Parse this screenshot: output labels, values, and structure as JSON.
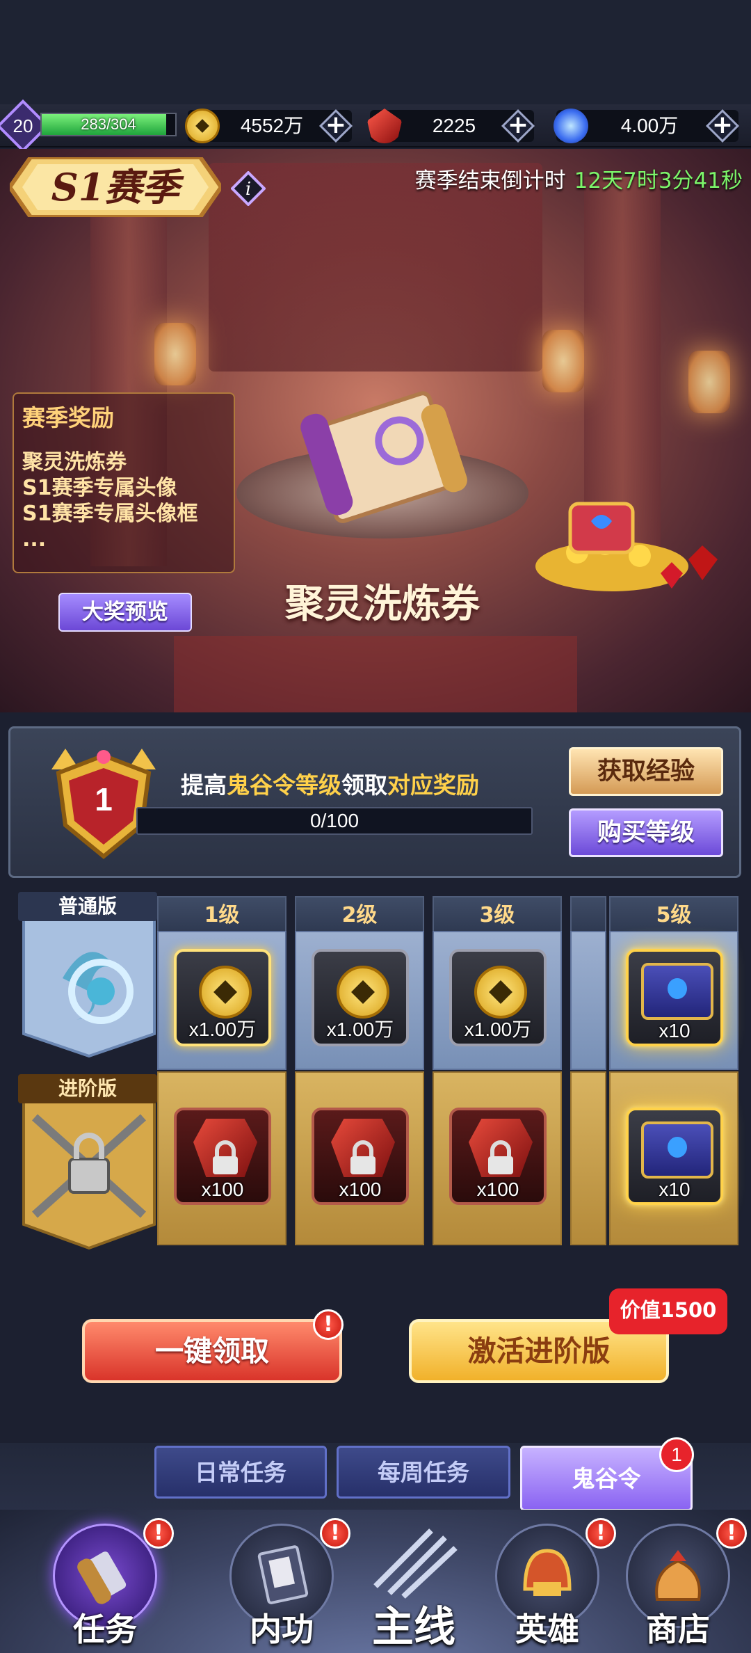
{
  "status_bar": {
    "level": "20",
    "xp": "283/304",
    "xp_fraction": 0.93,
    "gold": "4552万",
    "ruby": "2225",
    "crystal": "4.00万"
  },
  "banner": {
    "season_title": "S1赛季",
    "countdown_label": "赛季结束倒计时",
    "countdown_value": "12天7时3分41秒",
    "rewards_title": "赛季奖励",
    "rewards": [
      "聚灵洗炼券",
      "S1赛季专属头像",
      "S1赛季专属头像框",
      "..."
    ],
    "preview_button": "大奖预览",
    "featured_prize": "聚灵洗炼券"
  },
  "level_panel": {
    "current_level": "1",
    "desc_part1": "提高",
    "desc_hl1": "鬼谷令等级",
    "desc_part2": "领取",
    "desc_hl2": "对应奖励",
    "progress_text": "0/100",
    "progress_fraction": 0,
    "get_exp_button": "获取经验",
    "buy_level_button": "购买等级"
  },
  "tracks": {
    "normal_label": "普通版",
    "advanced_label": "进阶版",
    "columns": [
      {
        "level": "1级",
        "normal_qty": "x1.00万",
        "normal_type": "coin",
        "advanced_qty": "x100",
        "advanced_type": "gem-locked"
      },
      {
        "level": "2级",
        "normal_qty": "x1.00万",
        "normal_type": "coin",
        "advanced_qty": "x100",
        "advanced_type": "gem-locked"
      },
      {
        "level": "3级",
        "normal_qty": "x1.00万",
        "normal_type": "coin",
        "advanced_qty": "x100",
        "advanced_type": "gem-locked"
      },
      {
        "level": "5级",
        "normal_qty": "x10",
        "normal_type": "chest",
        "advanced_qty": "x10",
        "advanced_type": "chest-locked"
      }
    ]
  },
  "actions": {
    "claim_all": "一键领取",
    "activate_advanced": "激活进阶版",
    "value_tag": "价值1500"
  },
  "tabs": [
    {
      "label": "日常任务",
      "active": false
    },
    {
      "label": "每周任务",
      "active": false
    },
    {
      "label": "鬼谷令",
      "active": true,
      "badge": "1"
    }
  ],
  "bottom_nav": [
    {
      "label": "任务",
      "active": true,
      "icon": "scroll-icon"
    },
    {
      "label": "内功",
      "active": false,
      "icon": "book-icon"
    },
    {
      "label": "主线",
      "active": false,
      "icon": "claw-icon"
    },
    {
      "label": "英雄",
      "active": false,
      "icon": "helmet-icon"
    },
    {
      "label": "商店",
      "active": false,
      "icon": "bag-icon"
    }
  ],
  "colors": {
    "accent_purple": "#8a63f2",
    "countdown_green": "#7cf56a",
    "highlight_gold": "#ffd14a",
    "alert_red": "#e7232b"
  }
}
